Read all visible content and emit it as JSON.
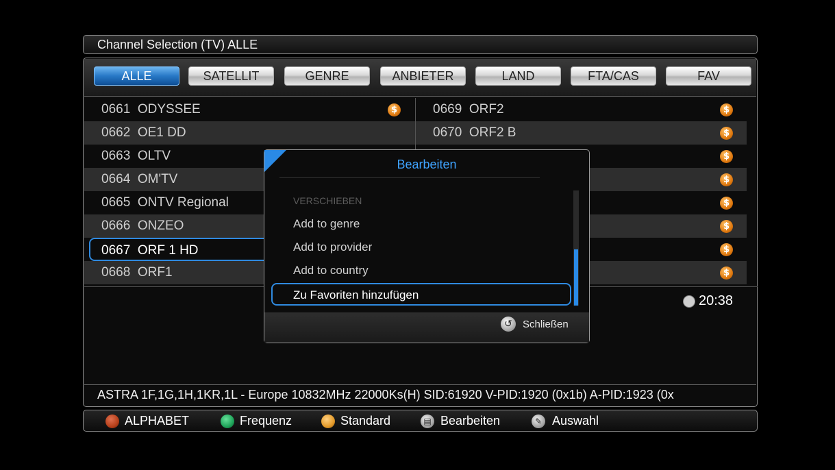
{
  "title": "Channel Selection (TV) ALLE",
  "tabs": [
    "ALLE",
    "SATELLIT",
    "GENRE",
    "ANBIETER",
    "LAND",
    "FTA/CAS",
    "FAV"
  ],
  "active_tab": "ALLE",
  "left_channels": [
    {
      "num": "0661",
      "name": "ODYSSEE",
      "encrypted": true
    },
    {
      "num": "0662",
      "name": "OE1 DD",
      "encrypted": false
    },
    {
      "num": "0663",
      "name": "OLTV",
      "encrypted": false
    },
    {
      "num": "0664",
      "name": "OM'TV",
      "encrypted": false
    },
    {
      "num": "0665",
      "name": "ONTV Regional",
      "encrypted": false
    },
    {
      "num": "0666",
      "name": "ONZEO",
      "encrypted": false
    },
    {
      "num": "0667",
      "name": "ORF 1 HD",
      "encrypted": false,
      "selected": true
    },
    {
      "num": "0668",
      "name": "ORF1",
      "encrypted": false
    }
  ],
  "right_channels": [
    {
      "num": "0669",
      "name": "ORF2",
      "encrypted": true
    },
    {
      "num": "0670",
      "name": "ORF2 B",
      "encrypted": true
    },
    {
      "encrypted": true
    },
    {
      "encrypted": true
    },
    {
      "encrypted": true
    },
    {
      "encrypted": true
    },
    {
      "encrypted": true
    },
    {
      "encrypted": true
    }
  ],
  "coin_symbol": "$",
  "clock": "20:38",
  "info_line": "ASTRA 1F,1G,1H,1KR,1L - Europe 10832MHz 22000Ks(H) SID:61920 V-PID:1920 (0x1b) A-PID:1923 (0x",
  "help": {
    "red_label": "ALPHABET",
    "green_label": "Frequenz",
    "yellow_label": "Standard",
    "menu_label": "Bearbeiten",
    "edit_label": "Auswahl",
    "colors": {
      "red": "#b7401a",
      "green": "#1fa45a",
      "yellow": "#e39a2a"
    }
  },
  "popup": {
    "title": "Bearbeiten",
    "items": [
      "VERSCHIEBEN",
      "Add to genre",
      "Add to provider",
      "Add to country",
      "Zu Favoriten hinzufügen"
    ],
    "selected_item": "Zu Favoriten hinzufügen",
    "close_label": "Schließen"
  },
  "accent_color": "#2f8ae0"
}
